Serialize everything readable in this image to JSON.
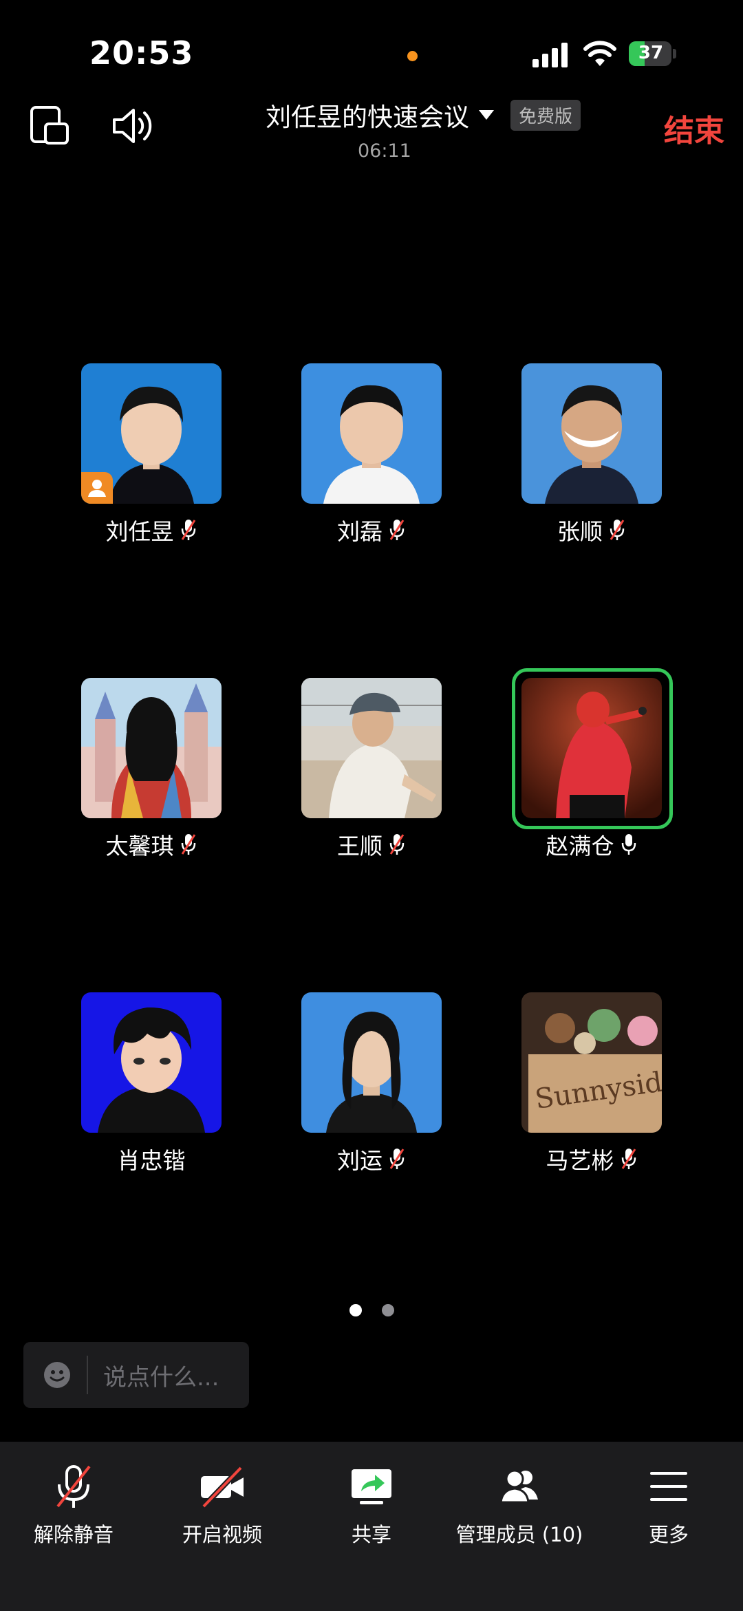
{
  "status_bar": {
    "time": "20:53",
    "battery": "37",
    "battery_level": 0.37
  },
  "header": {
    "title": "刘任昱的快速会议",
    "plan_badge": "免费版",
    "duration": "06:11",
    "end_label": "结束",
    "window_icon": "floating-window-icon",
    "speaker_icon": "speaker-icon"
  },
  "participants": [
    {
      "name": "刘任昱",
      "mic": "muted",
      "host": true
    },
    {
      "name": "刘磊",
      "mic": "muted"
    },
    {
      "name": "张顺",
      "mic": "muted"
    },
    {
      "name": "太馨琪",
      "mic": "muted"
    },
    {
      "name": "王顺",
      "mic": "muted"
    },
    {
      "name": "赵满仓",
      "mic": "on",
      "speaking": true
    },
    {
      "name": "肖忠锴",
      "mic": "none"
    },
    {
      "name": "刘运",
      "mic": "muted"
    },
    {
      "name": "马艺彬",
      "mic": "muted"
    }
  ],
  "pager": {
    "current": 1,
    "total": 2
  },
  "chat": {
    "placeholder": "说点什么..."
  },
  "toolbar": {
    "unmute": "解除静音",
    "video": "开启视频",
    "share": "共享",
    "members": "管理成员 (10)",
    "more": "更多"
  },
  "colors": {
    "accent_red": "#f2453d",
    "speaking_green": "#35c759",
    "host_orange": "#f08a24"
  }
}
